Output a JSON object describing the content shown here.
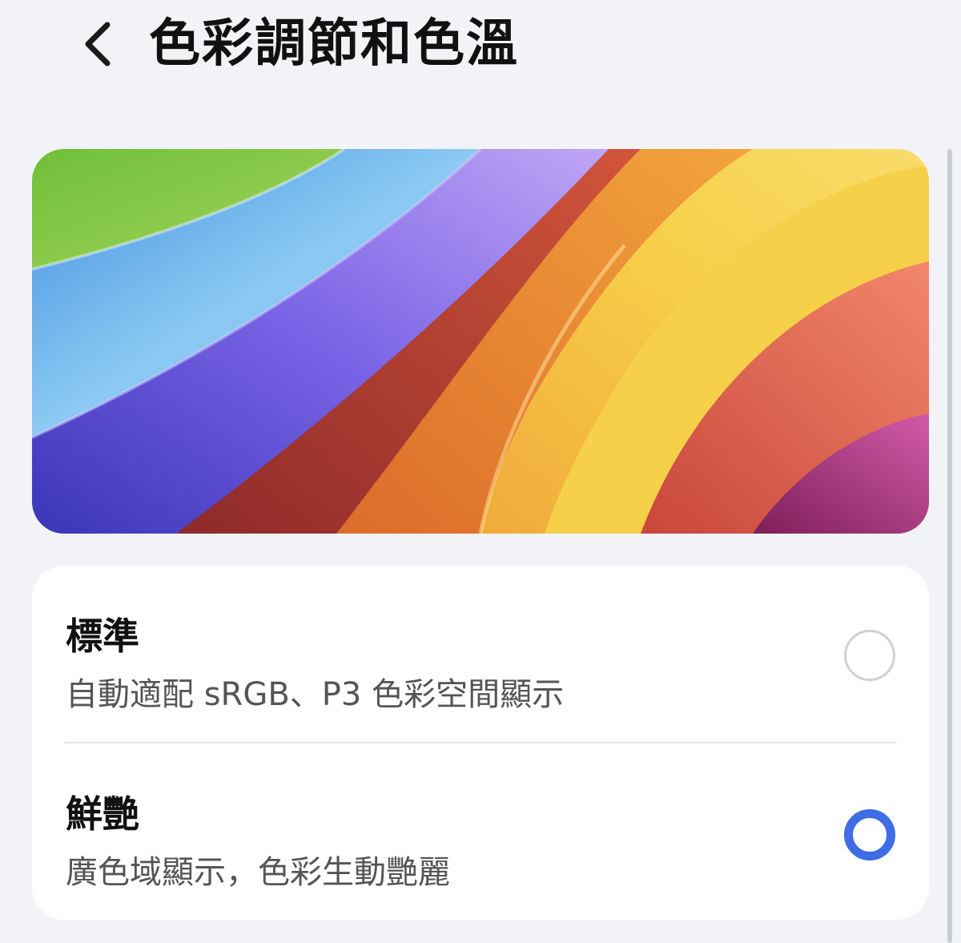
{
  "header": {
    "back_icon": "chevron-left-icon",
    "title": "色彩調節和色溫"
  },
  "banner": {
    "image": "rainbow-wave-wallpaper",
    "colors": [
      "#8cc63f",
      "#7ec3ef",
      "#6a4fd8",
      "#b33a2e",
      "#f08a2c",
      "#f5c542",
      "#ef7a62",
      "#b44a9c"
    ]
  },
  "options": [
    {
      "title": "標準",
      "subtitle": "自動適配 sRGB、P3 色彩空間顯示",
      "selected": false
    },
    {
      "title": "鮮艷",
      "subtitle": "廣色域顯示，色彩生動艷麗",
      "selected": true
    }
  ],
  "colors": {
    "background": "#f1f3f7",
    "accent": "#3f6de6",
    "card": "#ffffff"
  }
}
